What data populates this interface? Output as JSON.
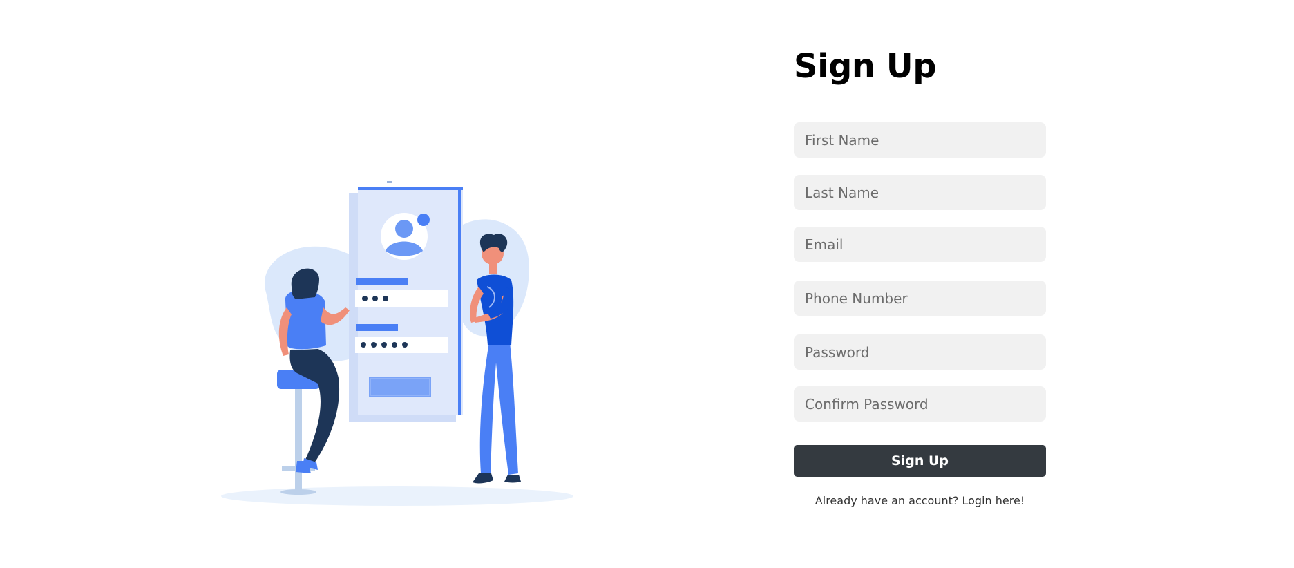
{
  "form": {
    "title": "Sign Up",
    "fields": {
      "first_name": {
        "placeholder": "First Name",
        "value": ""
      },
      "last_name": {
        "placeholder": "Last Name",
        "value": ""
      },
      "email": {
        "placeholder": "Email",
        "value": ""
      },
      "phone": {
        "placeholder": "Phone Number",
        "value": ""
      },
      "password": {
        "placeholder": "Password",
        "value": ""
      },
      "confirm_password": {
        "placeholder": "Confirm Password",
        "value": ""
      }
    },
    "submit_label": "Sign Up",
    "login_prompt": "Already have an account?",
    "login_link": "Login here!"
  },
  "illustration": {
    "icon": "signup-illustration",
    "colors": {
      "primary": "#4a7ff5",
      "dark": "#1d3557",
      "light_blob": "#dbe8fb",
      "skin": "#f0907a"
    }
  },
  "colors": {
    "button_bg": "#343a40",
    "field_bg": "#f1f1f1"
  }
}
